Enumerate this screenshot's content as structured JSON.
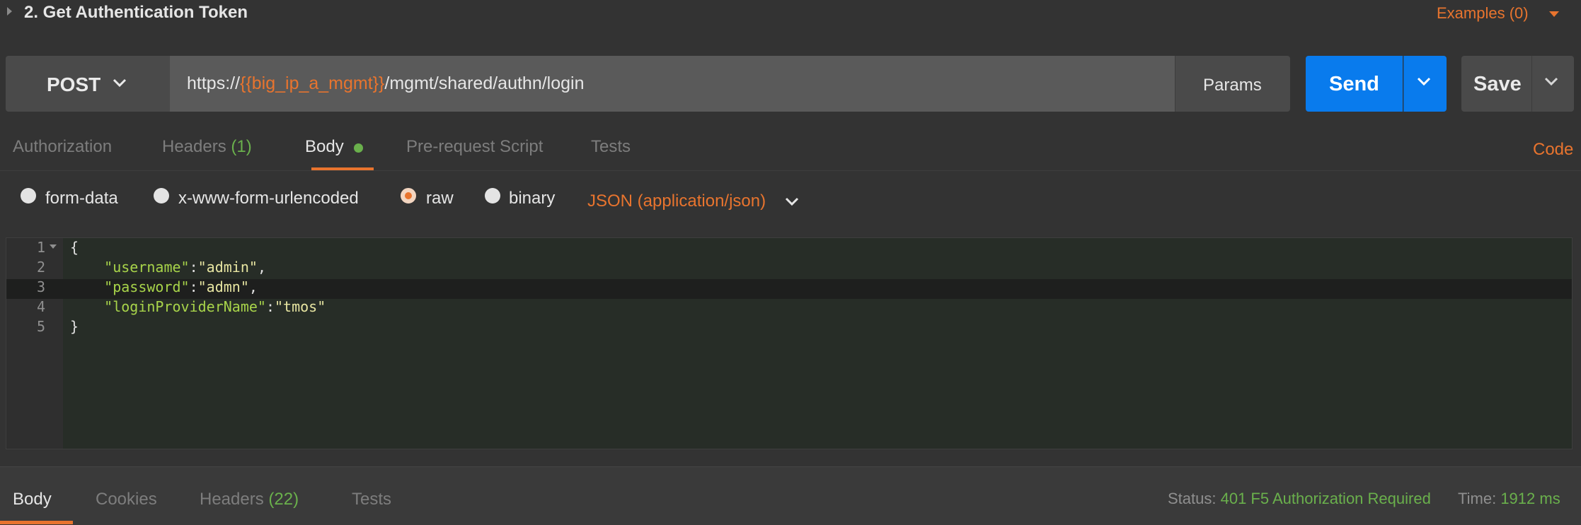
{
  "request": {
    "title": "2. Get Authentication Token",
    "examples_label": "Examples (0)"
  },
  "url_bar": {
    "method": "POST",
    "url_prefix": "https://",
    "url_variable": "{{big_ip_a_mgmt}}",
    "url_path": "/mgmt/shared/authn/login",
    "params_label": "Params",
    "send_label": "Send",
    "save_label": "Save"
  },
  "request_tabs": {
    "authorization": "Authorization",
    "headers": "Headers",
    "headers_count": "(1)",
    "body": "Body",
    "pre_request": "Pre-request Script",
    "tests": "Tests",
    "code_link": "Code"
  },
  "body_types": {
    "form_data": "form-data",
    "urlencoded": "x-www-form-urlencoded",
    "raw": "raw",
    "binary": "binary",
    "selected": "raw",
    "content_type": "JSON (application/json)"
  },
  "editor": {
    "line_numbers": [
      "1",
      "2",
      "3",
      "4",
      "5"
    ],
    "lines": [
      {
        "open": "{"
      },
      {
        "indent": "    ",
        "key": "\"username\"",
        "sep": ":",
        "value": "\"admin\"",
        "end": ","
      },
      {
        "indent": "    ",
        "key": "\"password\"",
        "sep": ":",
        "value": "\"admn\"",
        "end": ","
      },
      {
        "indent": "    ",
        "key": "\"loginProviderName\"",
        "sep": ":",
        "value": "\"tmos\"",
        "end": ""
      },
      {
        "close": "}"
      }
    ],
    "active_line": 3
  },
  "response_tabs": {
    "body": "Body",
    "cookies": "Cookies",
    "headers": "Headers",
    "headers_count": "(22)",
    "tests": "Tests"
  },
  "response_status": {
    "status_label": "Status:",
    "status_value": "401 F5 Authorization Required",
    "time_label": "Time:",
    "time_value": "1912 ms"
  },
  "colors": {
    "accent": "#e8742e",
    "send_blue": "#097bed",
    "success_green": "#6ab04c",
    "background": "#333333"
  }
}
